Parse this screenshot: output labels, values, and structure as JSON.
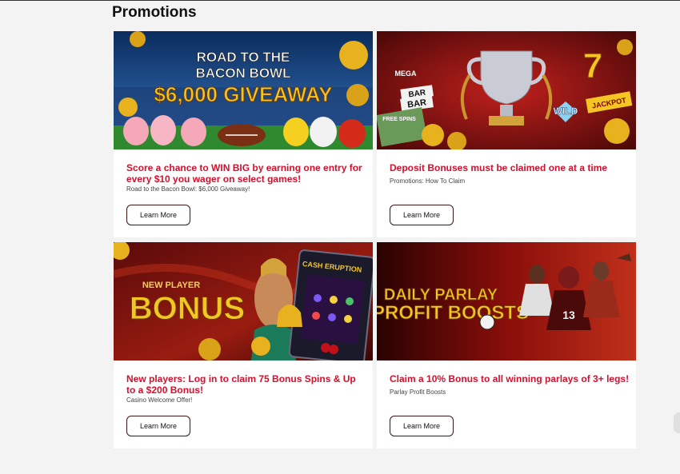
{
  "page": {
    "title": "Promotions"
  },
  "colors": {
    "accent": "#d4102d",
    "button_border": "#3b1414"
  },
  "cards": [
    {
      "banner_lines": [
        "ROAD TO THE",
        "BACON BOWL",
        "$6,000 GIVEAWAY"
      ],
      "headline": "Score a chance to WIN BIG by earning one entry for every $10 you wager on select games!",
      "subtitle": "Road to the Bacon Bowl: $6,000 Giveaway!",
      "button_label": "Learn More"
    },
    {
      "banner_lines": [
        "MEGA",
        "BAR",
        "BAR",
        "FREE SPINS",
        "WILD",
        "JACKPOT",
        "7"
      ],
      "headline": "Deposit Bonuses must be claimed one at a time",
      "subtitle": "Promotions: How To Claim",
      "button_label": "Learn More"
    },
    {
      "banner_lines": [
        "NEW PLAYER",
        "BONUS",
        "CASH ERUPTION"
      ],
      "headline": "New players: Log in to claim 75 Bonus Spins & Up to a $200 Bonus!",
      "subtitle": "Casino Welcome Offer!",
      "button_label": "Learn More"
    },
    {
      "banner_lines": [
        "DAILY PARLAY",
        "PROFIT BOOSTS",
        "13"
      ],
      "headline": "Claim a 10% Bonus to all winning parlays of 3+ legs!",
      "subtitle": "Parlay Profit Boosts",
      "button_label": "Learn More"
    }
  ]
}
